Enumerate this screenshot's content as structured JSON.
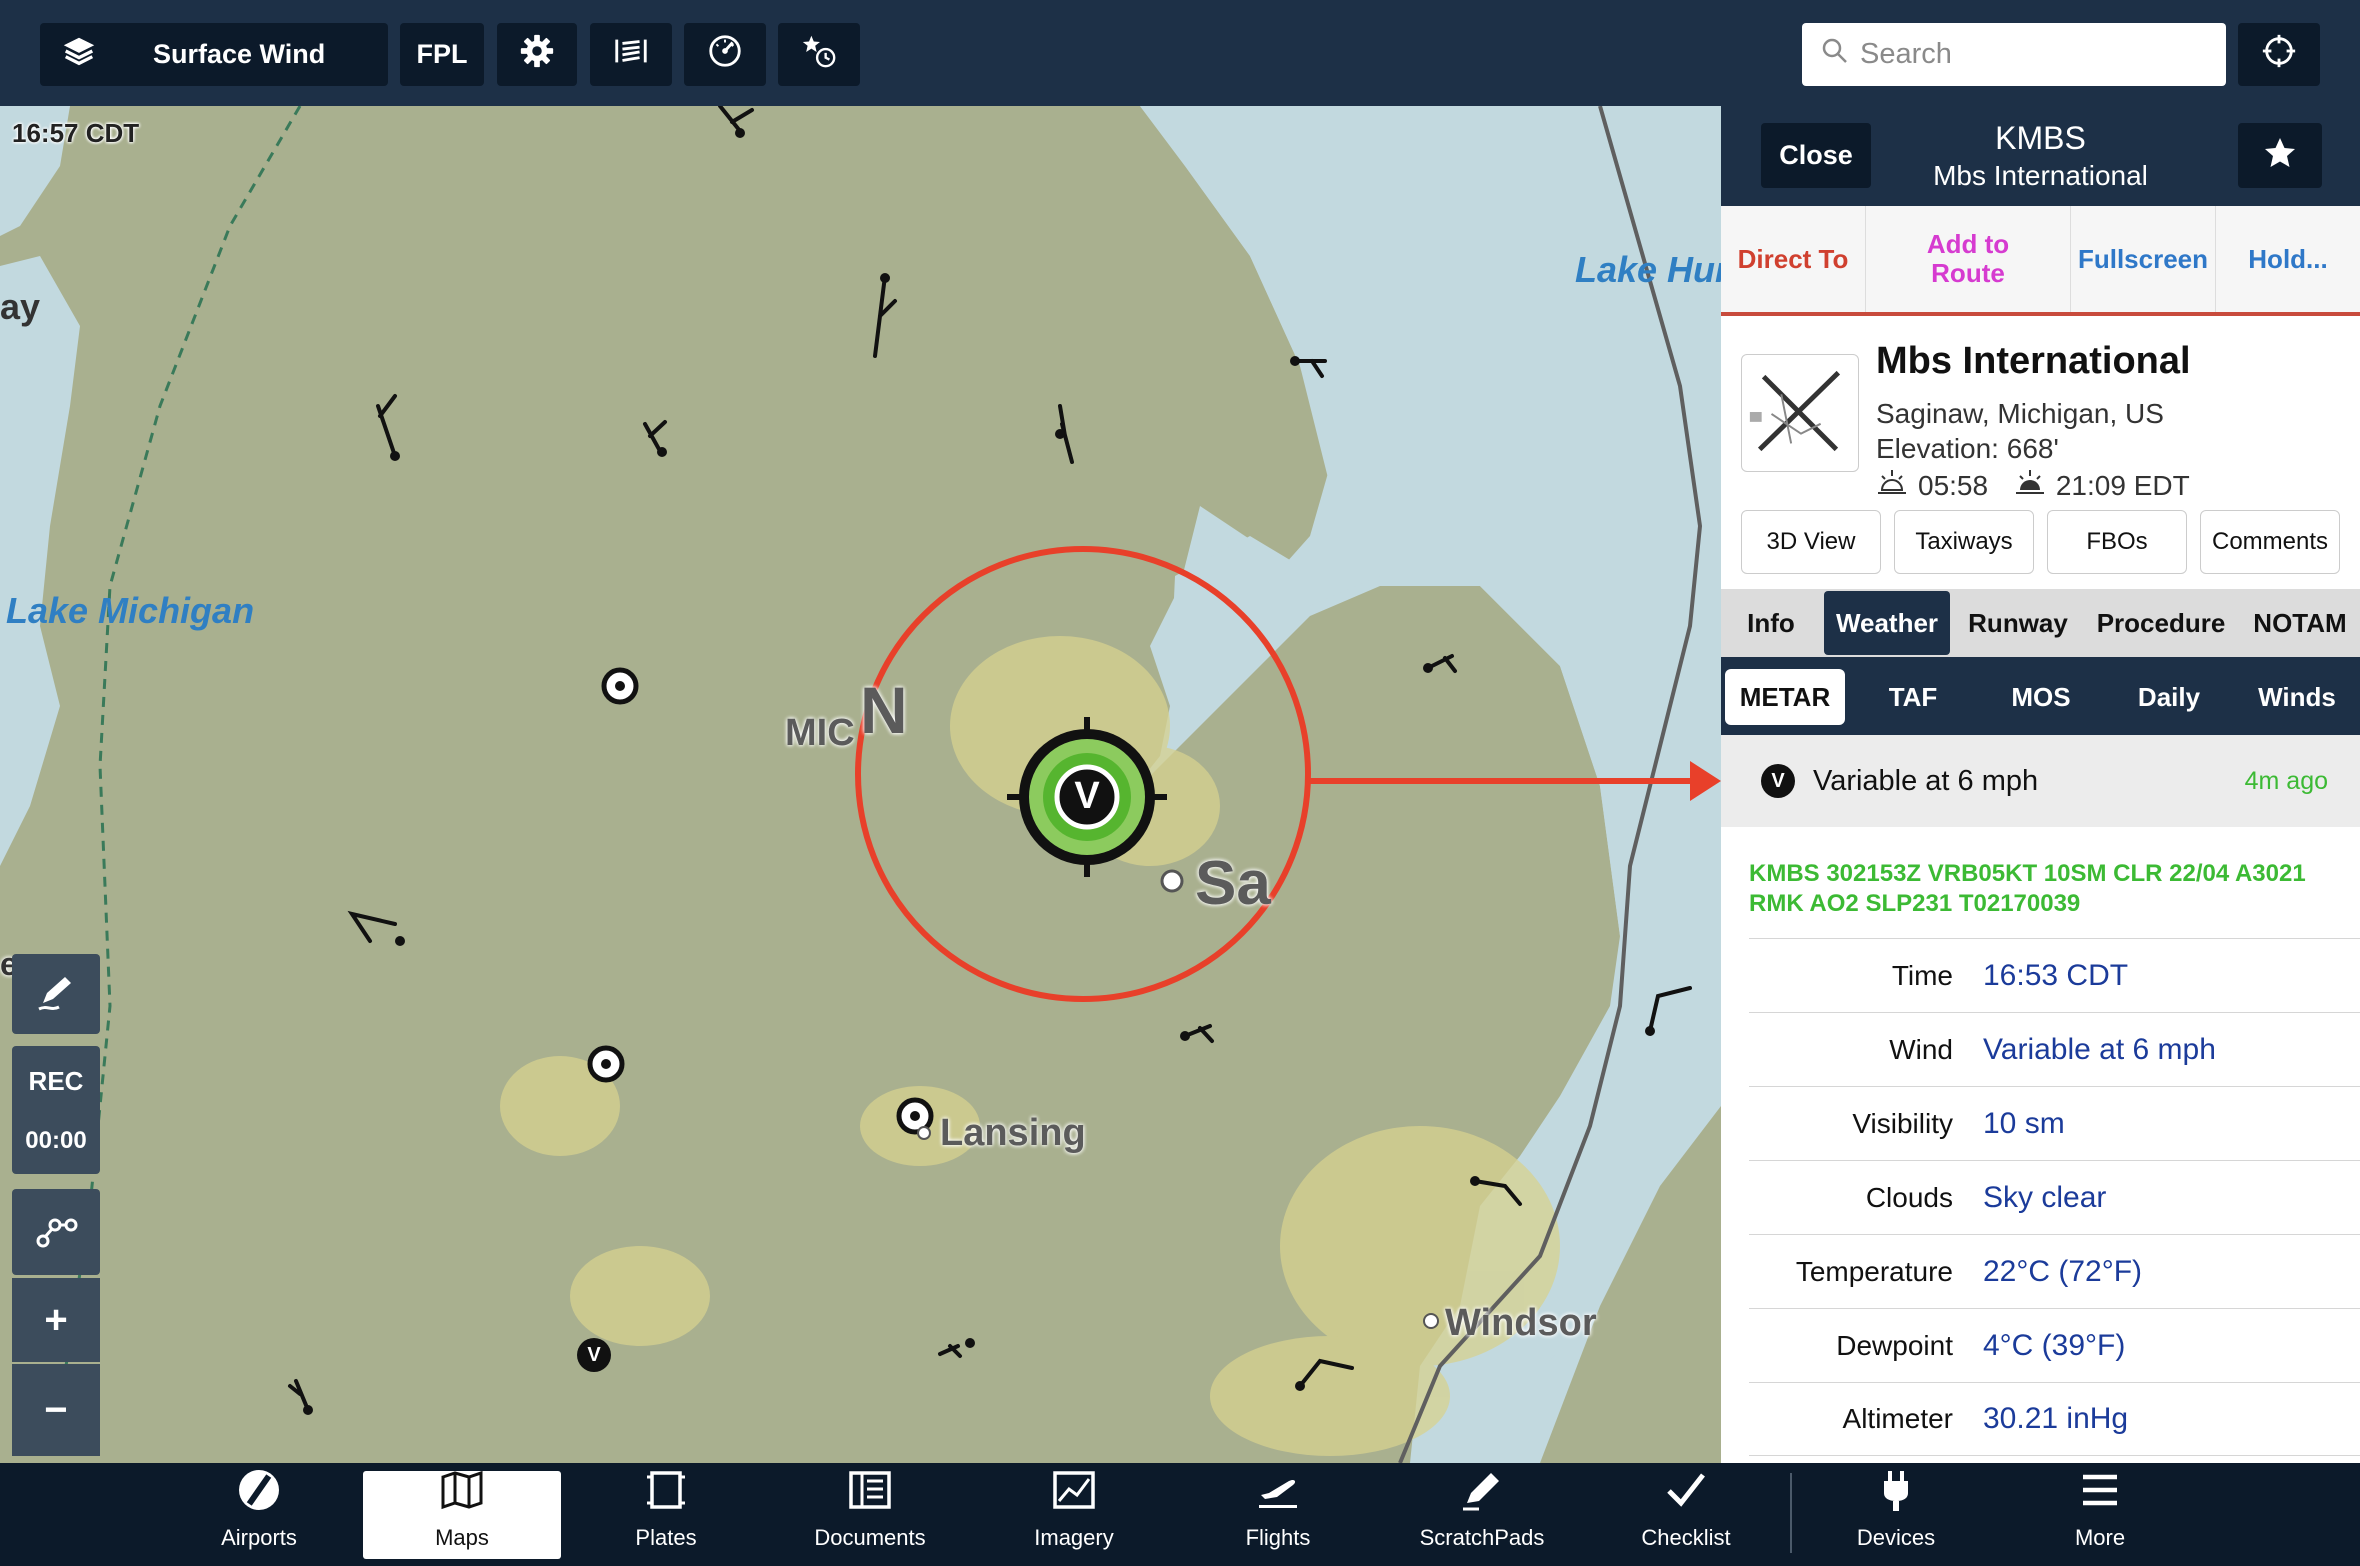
{
  "toolbar": {
    "layer_label": "Surface Wind",
    "fpl_label": "FPL",
    "search_placeholder": "Search"
  },
  "map": {
    "time": "16:57 CDT",
    "labels": {
      "lake_michigan": "Lake Michigan",
      "lake_huron": "Lake Hur",
      "bay": "ay",
      "mic": "MIC",
      "n": "N",
      "sa": "Sa",
      "lansing": "Lansing",
      "windsor": "Windsor",
      "ee": "ee"
    },
    "controls": {
      "rec_label": "REC",
      "rec_time": "00:00",
      "zoom_in": "+",
      "zoom_out": "−"
    },
    "selected_marker_letter": "V",
    "small_marker_letter": "V"
  },
  "panel": {
    "close_label": "Close",
    "code": "KMBS",
    "subtitle": "Mbs International",
    "actions": [
      {
        "label": "Direct To",
        "color": "#d0402f"
      },
      {
        "label": "Add to Route",
        "color": "#d63bd0"
      },
      {
        "label": "Fullscreen",
        "color": "#2f78c8"
      },
      {
        "label": "Hold...",
        "color": "#2f78c8"
      }
    ],
    "airport": {
      "name": "Mbs International",
      "location": "Saginaw, Michigan, US",
      "elevation": "Elevation: 668'",
      "sunrise": "05:58",
      "sunset": "21:09 EDT"
    },
    "buttons": [
      "3D View",
      "Taxiways",
      "FBOs",
      "Comments"
    ],
    "tabs": [
      "Info",
      "Weather",
      "Runway",
      "Procedure",
      "NOTAM"
    ],
    "selected_tab": "Weather",
    "subtabs": [
      "METAR",
      "TAF",
      "MOS",
      "Daily",
      "Winds"
    ],
    "selected_subtab": "METAR",
    "summary": {
      "badge": "V",
      "text": "Variable at 6 mph",
      "age": "4m ago"
    },
    "raw_metar": "KMBS 302153Z VRB05KT 10SM CLR 22/04 A3021 RMK AO2 SLP231 T02170039",
    "rows": [
      {
        "key": "Time",
        "value": "16:53 CDT"
      },
      {
        "key": "Wind",
        "value": "Variable at 6 mph"
      },
      {
        "key": "Visibility",
        "value": "10 sm"
      },
      {
        "key": "Clouds",
        "value": "Sky clear"
      },
      {
        "key": "Temperature",
        "value": "22°C (72°F)"
      },
      {
        "key": "Dewpoint",
        "value": "4°C (39°F)"
      },
      {
        "key": "Altimeter",
        "value": "30.21 inHg"
      }
    ]
  },
  "bottombar": {
    "items": [
      "Airports",
      "Maps",
      "Plates",
      "Documents",
      "Imagery",
      "Flights",
      "ScratchPads",
      "Checklist",
      "Devices",
      "More"
    ],
    "selected": "Maps"
  },
  "colors": {
    "navy": "#1d3047",
    "dark": "#0c1a2a",
    "accent_red": "#e8402a",
    "metar_green": "#3cba34",
    "value_blue": "#1b3b9a"
  }
}
